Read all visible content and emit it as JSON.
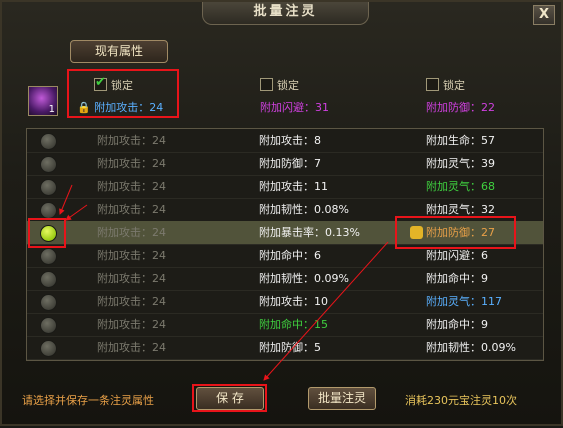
{
  "dialog": {
    "title": "批量注灵",
    "close_label": "X"
  },
  "tab": {
    "label": "现有属性"
  },
  "item": {
    "count": "1"
  },
  "locks": [
    {
      "label": "锁定",
      "checked": true,
      "value": "附加攻击：24",
      "color": "#5ab0ff"
    },
    {
      "label": "锁定",
      "checked": false,
      "value": "附加闪避：31",
      "color": "#d040e0"
    },
    {
      "label": "锁定",
      "checked": false,
      "value": "附加防御：22",
      "color": "#d040e0"
    }
  ],
  "rows": [
    {
      "c1": "附加攻击：24",
      "c2": "附加攻击：8",
      "c2_color": "#f2f2f2",
      "c3": "附加生命：57",
      "c3_color": "#f2f2f2",
      "selected": false
    },
    {
      "c1": "附加攻击：24",
      "c2": "附加防御：7",
      "c2_color": "#f2f2f2",
      "c3": "附加灵气：39",
      "c3_color": "#f2f2f2",
      "selected": false
    },
    {
      "c1": "附加攻击：24",
      "c2": "附加攻击：11",
      "c2_color": "#f2f2f2",
      "c3": "附加灵气：68",
      "c3_color": "#3fd03f",
      "selected": false
    },
    {
      "c1": "附加攻击：24",
      "c2": "附加韧性：0.08%",
      "c2_color": "#f2f2f2",
      "c3": "附加灵气：32",
      "c3_color": "#f2f2f2",
      "selected": false
    },
    {
      "c1": "附加攻击：24",
      "c2": "附加暴击率：0.13%",
      "c2_color": "#f2f2f2",
      "c3": "附加防御：27",
      "c3_color": "#e8a048",
      "selected": true
    },
    {
      "c1": "附加攻击：24",
      "c2": "附加命中：6",
      "c2_color": "#f2f2f2",
      "c3": "附加闪避：6",
      "c3_color": "#f2f2f2",
      "selected": false
    },
    {
      "c1": "附加攻击：24",
      "c2": "附加韧性：0.09%",
      "c2_color": "#f2f2f2",
      "c3": "附加命中：9",
      "c3_color": "#f2f2f2",
      "selected": false
    },
    {
      "c1": "附加攻击：24",
      "c2": "附加攻击：10",
      "c2_color": "#f2f2f2",
      "c3": "附加灵气：117",
      "c3_color": "#5ab0ff",
      "selected": false
    },
    {
      "c1": "附加攻击：24",
      "c2": "附加命中：15",
      "c2_color": "#3fd03f",
      "c3": "附加命中：9",
      "c3_color": "#f2f2f2",
      "selected": false
    },
    {
      "c1": "附加攻击：24",
      "c2": "附加防御：5",
      "c2_color": "#f2f2f2",
      "c3": "附加韧性：0.09%",
      "c3_color": "#f2f2f2",
      "selected": false
    }
  ],
  "footer": {
    "hint": "请选择并保存一条注灵属性",
    "save_label": "保 存",
    "batch_label": "批量注灵",
    "cost": "消耗230元宝注灵10次"
  }
}
